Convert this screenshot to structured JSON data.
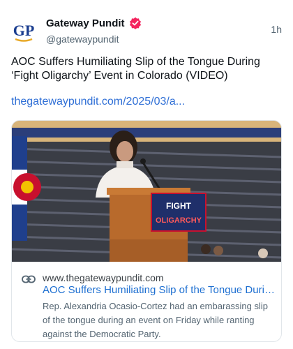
{
  "post": {
    "author": {
      "display_name": "Gateway Pundit",
      "handle": "@gatewaypundit",
      "avatar_text": "GP",
      "verified_icon": "verified-badge-icon",
      "verified_color": "#f4245e"
    },
    "timestamp": "1h",
    "text": "AOC Suffers Humiliating Slip of the Tongue During ‘Fight Oligarchy’ Event in Colorado (VIDEO)",
    "link_text": "thegatewaypundit.com/2025/03/a...",
    "card": {
      "image_sign_line1": "FIGHT",
      "image_sign_line2": "OLIGARCHY",
      "link_icon": "link-icon",
      "domain": "www.thegatewaypundit.com",
      "title": "AOC Suffers Humiliating Slip of the Tongue During ‘Fight Oligarchy’ Event in Colorado (VIDEO)",
      "description": "Rep. Alexandria Ocasio-Cortez had an embarassing slip of the tongue during an event on Friday while ranting against the Democratic Party."
    }
  },
  "colors": {
    "link": "#2f6fd6",
    "avatar_blue": "#1a3d8f",
    "avatar_gold": "#e8a928"
  }
}
